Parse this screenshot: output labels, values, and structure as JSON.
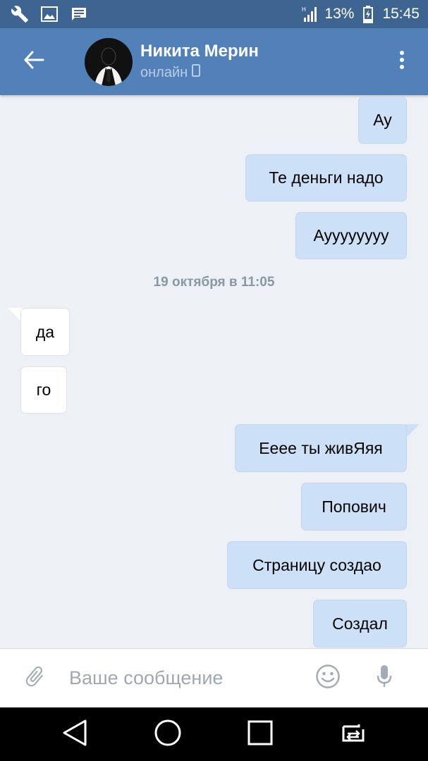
{
  "status_bar": {
    "battery_percent": "13%",
    "time": "15:45",
    "icons": [
      "wrench-icon",
      "image-icon",
      "message-icon",
      "signal-icon",
      "battery-icon"
    ]
  },
  "header": {
    "contact_name": "Никита Мерин",
    "presence": "онлайн",
    "icons": [
      "back-arrow-icon",
      "mobile-device-icon",
      "more-vertical-icon"
    ]
  },
  "conversation": {
    "messages_before_date": [
      {
        "direction": "out",
        "text": "Ау"
      },
      {
        "direction": "out",
        "text": "Те деньги надо"
      },
      {
        "direction": "out",
        "text": "Ауууууууу"
      }
    ],
    "date_separator": "19 октября в 11:05",
    "messages_after_date": [
      {
        "direction": "in",
        "text": "да"
      },
      {
        "direction": "in",
        "text": "го"
      },
      {
        "direction": "out",
        "text": "Еeee ты живЯяя"
      },
      {
        "direction": "out",
        "text": "Попович"
      },
      {
        "direction": "out",
        "text": "Страницу создао"
      },
      {
        "direction": "out",
        "text": "Создал"
      }
    ]
  },
  "composer": {
    "placeholder": "Ваше сообщение",
    "icons": [
      "paperclip-icon",
      "emoji-icon",
      "microphone-icon"
    ]
  },
  "nav_bar": {
    "icons": [
      "back-triangle-icon",
      "home-circle-icon",
      "recents-square-icon",
      "switch-apps-icon"
    ]
  },
  "colors": {
    "status_bar": "#3e6591",
    "app_bar": "#5181b8",
    "background": "#edf0f4",
    "outgoing_bubble": "#cce1f7",
    "incoming_bubble": "#ffffff"
  }
}
